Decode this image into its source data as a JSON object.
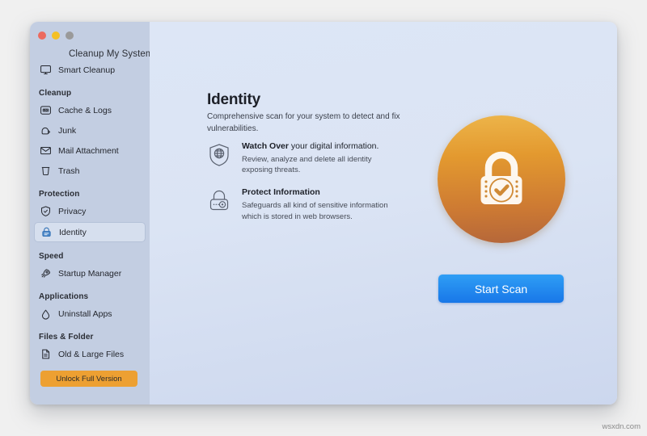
{
  "window": {
    "title": "Cleanup My System",
    "traffic_lights": [
      {
        "name": "close",
        "color": "#ec6a5f"
      },
      {
        "name": "minimize",
        "color": "#f4c025"
      },
      {
        "name": "zoom",
        "color": "#9a9a9a"
      }
    ]
  },
  "sidebar": {
    "top_item": {
      "label": "Smart Cleanup",
      "icon": "monitor-icon"
    },
    "sections": [
      {
        "label": "Cleanup",
        "items": [
          {
            "label": "Cache & Logs",
            "icon": "log-badge-icon",
            "selected": false
          },
          {
            "label": "Junk",
            "icon": "junk-icon",
            "selected": false
          },
          {
            "label": "Mail Attachment",
            "icon": "envelope-icon",
            "selected": false
          },
          {
            "label": "Trash",
            "icon": "trash-icon",
            "selected": false
          }
        ]
      },
      {
        "label": "Protection",
        "items": [
          {
            "label": "Privacy",
            "icon": "shield-check-icon",
            "selected": false
          },
          {
            "label": "Identity",
            "icon": "lock-icon",
            "selected": true
          }
        ]
      },
      {
        "label": "Speed",
        "items": [
          {
            "label": "Startup Manager",
            "icon": "rocket-icon",
            "selected": false
          }
        ]
      },
      {
        "label": "Applications",
        "items": [
          {
            "label": "Uninstall Apps",
            "icon": "uninstall-icon",
            "selected": false
          }
        ]
      },
      {
        "label": "Files & Folder",
        "items": [
          {
            "label": "Old & Large Files",
            "icon": "document-icon",
            "selected": false
          }
        ]
      }
    ],
    "unlock_button": "Unlock Full Version",
    "unlock_color": "#eda032"
  },
  "main": {
    "title": "Identity",
    "subtitle": "Comprehensive scan for your system to detect and fix vulnerabilities.",
    "features": [
      {
        "title_bold": "Watch Over",
        "title_rest": " your digital information.",
        "description": "Review, analyze and delete all identity exposing threats.",
        "icon": "shield-globe-icon"
      },
      {
        "title_bold": "Protect Information",
        "title_rest": "",
        "description": "Safeguards all kind of sensitive information which is stored in web browsers.",
        "icon": "padlock-keyhole-icon"
      }
    ],
    "hero_badge": {
      "icon": "lock-check-badge-icon",
      "gradient_from": "#edb54a",
      "gradient_to": "#b4663a"
    },
    "start_scan_button": "Start Scan",
    "start_scan_color": "#1877e8"
  },
  "watermark": "wsxdn.com"
}
